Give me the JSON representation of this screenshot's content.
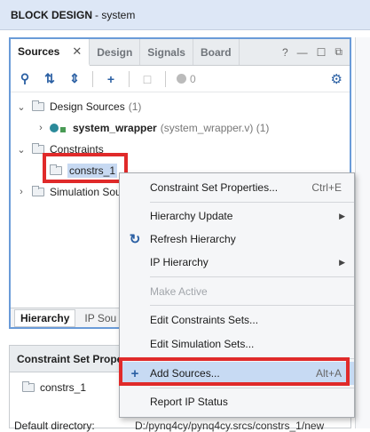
{
  "window": {
    "title_bold": "BLOCK DESIGN",
    "title_rest": "- system"
  },
  "sources_panel": {
    "tabs": [
      {
        "label": "Sources",
        "active": true
      },
      {
        "label": "Design",
        "active": false
      },
      {
        "label": "Signals",
        "active": false
      },
      {
        "label": "Board",
        "active": false
      }
    ],
    "tab_close": "✕",
    "tab_tools": {
      "help": "?",
      "minimize": "—",
      "maximize": "☐",
      "float": "⧉"
    },
    "toolbar": {
      "count": "0"
    },
    "tree": {
      "design_sources": {
        "label": "Design Sources",
        "count": "(1)"
      },
      "system_wrapper": {
        "label": "system_wrapper",
        "detail": "(system_wrapper.v) (1)"
      },
      "constraints": {
        "label": "Constraints"
      },
      "constrs_1": {
        "label": "constrs_1"
      },
      "simulation_sources": {
        "label": "Simulation Sou"
      }
    },
    "bottom_tabs": [
      {
        "label": "Hierarchy",
        "active": true
      },
      {
        "label": "IP Sou",
        "active": false
      }
    ]
  },
  "properties_panel": {
    "title": "Constraint Set Prope",
    "item": "constrs_1",
    "default_directory_label": "Default directory:",
    "default_directory_value": "D:/pynq4cy/pynq4cy.srcs/constrs_1/new"
  },
  "context_menu": {
    "items": [
      {
        "label": "Constraint Set Properties...",
        "shortcut": "Ctrl+E",
        "icon": "",
        "submenu": false,
        "disabled": false
      },
      {
        "label": "Hierarchy Update",
        "shortcut": "",
        "icon": "",
        "submenu": true,
        "disabled": false
      },
      {
        "label": "Refresh Hierarchy",
        "shortcut": "",
        "icon": "refresh-icon",
        "submenu": false,
        "disabled": false
      },
      {
        "label": "IP Hierarchy",
        "shortcut": "",
        "icon": "",
        "submenu": true,
        "disabled": false
      },
      {
        "label": "Make Active",
        "shortcut": "",
        "icon": "",
        "submenu": false,
        "disabled": true
      },
      {
        "label": "Edit Constraints Sets...",
        "shortcut": "",
        "icon": "",
        "submenu": false,
        "disabled": false
      },
      {
        "label": "Edit Simulation Sets...",
        "shortcut": "",
        "icon": "",
        "submenu": false,
        "disabled": false
      },
      {
        "label": "Add Sources...",
        "shortcut": "Alt+A",
        "icon": "plus-icon",
        "submenu": false,
        "disabled": false,
        "highlighted": true
      },
      {
        "label": "Report IP Status",
        "shortcut": "",
        "icon": "",
        "submenu": false,
        "disabled": false
      }
    ]
  },
  "colors": {
    "accent": "#2a5fa3",
    "highlight_box": "#e02a2a",
    "selection": "#c7daf3"
  }
}
